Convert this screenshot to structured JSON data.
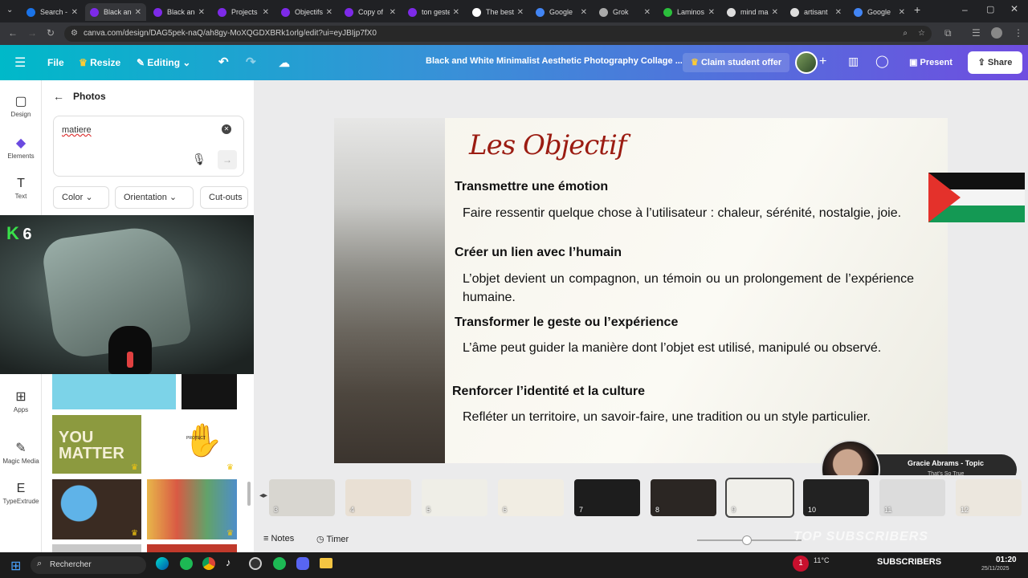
{
  "browser": {
    "tabs": [
      {
        "label": "Search -",
        "color": "#1a73e8",
        "active": false
      },
      {
        "label": "Black and",
        "color": "#7d2ae8",
        "active": true
      },
      {
        "label": "Black and",
        "color": "#7d2ae8",
        "active": false
      },
      {
        "label": "Projects",
        "color": "#7d2ae8",
        "active": false
      },
      {
        "label": "Objectifs",
        "color": "#7d2ae8",
        "active": false
      },
      {
        "label": "Copy of",
        "color": "#7d2ae8",
        "active": false
      },
      {
        "label": "ton geste",
        "color": "#7d2ae8",
        "active": false
      },
      {
        "label": "The best",
        "color": "#ffffff",
        "active": false
      },
      {
        "label": "Google",
        "color": "#4285f4",
        "active": false
      },
      {
        "label": "Grok",
        "color": "#aaaaaa",
        "active": false
      },
      {
        "label": "Laminos",
        "color": "#2bbf3c",
        "active": false
      },
      {
        "label": "mind ma",
        "color": "#dddddd",
        "active": false
      },
      {
        "label": "artisant",
        "color": "#dddddd",
        "active": false
      },
      {
        "label": "Google",
        "color": "#4285f4",
        "active": false
      }
    ],
    "url": "canva.com/design/DAG5pek-naQ/ah8gy-MoXQGDXBRk1orlg/edit?ui=eyJBIjp7fX0"
  },
  "header": {
    "file": "File",
    "resize": "Resize",
    "editing": "Editing",
    "title": "Black and White Minimalist Aesthetic Photography Collage ...",
    "claim": "Claim student offer",
    "present": "Present",
    "share": "Share"
  },
  "rail": [
    {
      "label": "Design",
      "icon": "design-icon",
      "glyph": "▢"
    },
    {
      "label": "Elements",
      "icon": "elements-icon",
      "glyph": "◆"
    },
    {
      "label": "Text",
      "icon": "text-icon",
      "glyph": "T"
    },
    {
      "label": "Apps",
      "icon": "apps-icon",
      "glyph": "⊞"
    },
    {
      "label": "Magic Media",
      "icon": "magic-media-icon",
      "glyph": "✎"
    },
    {
      "label": "TypeExtrude",
      "icon": "typeextrude-icon",
      "glyph": "E"
    }
  ],
  "panel": {
    "title": "Photos",
    "search_value": "matiere",
    "filters": [
      "Color",
      "Orientation",
      "Cut-outs"
    ],
    "photo_tiles": [
      "YOU MATTER",
      "PROTECT"
    ]
  },
  "webcam": {
    "badge_letter": "K",
    "badge_number": "6"
  },
  "slide": {
    "title": "Les Objectif",
    "sections": [
      {
        "heading": "Transmettre une émotion",
        "text": "Faire ressentir quelque chose à l’utilisateur : chaleur, sérénité, nostalgie, joie."
      },
      {
        "heading": "Créer un lien avec l’humain",
        "text": "L’objet devient un compagnon, un témoin ou un prolongement de l’expérience humaine."
      },
      {
        "heading": "Transformer le geste ou l’expérience",
        "text": "L’âme peut guider la manière dont l’objet est utilisé, manipulé ou observé."
      },
      {
        "heading": "Renforcer l’identité et la culture",
        "text": "Refléter un territoire, un savoir-faire, une tradition ou un style particulier."
      }
    ]
  },
  "music": {
    "artist": "Gracie Abrams - Topic",
    "song": "That’s So True"
  },
  "filmstrip": {
    "pages": [
      "3",
      "4",
      "5",
      "6",
      "7",
      "8",
      "9",
      "10",
      "11",
      "12"
    ],
    "active_page": "9"
  },
  "footer": {
    "notes": "Notes",
    "timer": "Timer",
    "overlay_text": "TOP SUBSCRIBERS"
  },
  "taskbar": {
    "search_placeholder": "Rechercher",
    "weather": "11°C",
    "subscribers_label": "SUBSCRIBERS",
    "time": "01:20",
    "date": "25/11/2025",
    "notification_count": "1"
  },
  "colors": {
    "canva_gradient_start": "#00b9c9",
    "canva_gradient_end": "#6f4de0",
    "slide_title": "#9b1c12",
    "flag_red": "#e4312b",
    "flag_green": "#149954"
  }
}
